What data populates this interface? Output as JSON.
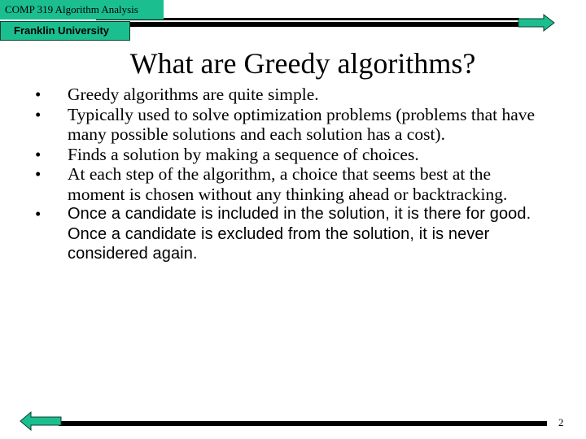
{
  "header": {
    "course_label": "COMP 319 Algorithm Analysis",
    "university_label": "Franklin University"
  },
  "slide": {
    "title": "What are Greedy algorithms?",
    "bullets": [
      {
        "text": "Greedy algorithms are quite simple."
      },
      {
        "text": "Typically used to solve optimization problems (problems that have many possible solutions and each solution has a cost)."
      },
      {
        "text": "Finds a solution by making a sequence of choices."
      },
      {
        "text": "At each step of the algorithm, a choice that seems best at the moment is chosen without any thinking ahead or backtracking."
      },
      {
        "text": "Once a candidate is included in the solution, it is there for good. Once a candidate is excluded from the solution, it is never considered again."
      }
    ],
    "bullet_glyph": "•"
  },
  "footer": {
    "page_number": "2"
  },
  "navigation": {
    "next_icon": "right-arrow-icon",
    "prev_icon": "left-arrow-icon"
  },
  "colors": {
    "accent": "#1bbf8f",
    "bar": "#000000"
  }
}
